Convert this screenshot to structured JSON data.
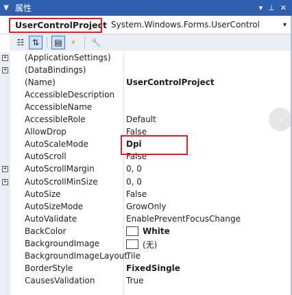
{
  "window": {
    "title": "属性",
    "menu_icon": "triangle-down-icon",
    "controls": {
      "dropdown": "▾",
      "pin": "⊥",
      "close": "✕"
    }
  },
  "object_selector": {
    "name": "UserControlProject",
    "type": "System.Windows.Forms.UserControl"
  },
  "toolbar": {
    "buttons": [
      {
        "icon": "categorized-icon",
        "glyph": "☷",
        "active": false
      },
      {
        "icon": "alphabetical-icon",
        "glyph": "⇅",
        "active": true
      },
      {
        "icon": "properties-icon",
        "glyph": "▤",
        "active": true
      },
      {
        "icon": "events-icon",
        "glyph": "⚡",
        "active": false
      },
      {
        "icon": "property-pages-icon",
        "glyph": "🔧",
        "active": false
      }
    ]
  },
  "properties": [
    {
      "name": "(ApplicationSettings)",
      "value": "",
      "expandable": true
    },
    {
      "name": "(DataBindings)",
      "value": "",
      "expandable": true
    },
    {
      "name": "(Name)",
      "value": "UserControlProject",
      "bold": true
    },
    {
      "name": "AccessibleDescription",
      "value": ""
    },
    {
      "name": "AccessibleName",
      "value": ""
    },
    {
      "name": "AccessibleRole",
      "value": "Default"
    },
    {
      "name": "AllowDrop",
      "value": "False"
    },
    {
      "name": "AutoScaleMode",
      "value": "Dpi",
      "bold": true
    },
    {
      "name": "AutoScroll",
      "value": "False"
    },
    {
      "name": "AutoScrollMargin",
      "value": "0, 0",
      "expandable": true
    },
    {
      "name": "AutoScrollMinSize",
      "value": "0, 0",
      "expandable": true
    },
    {
      "name": "AutoSize",
      "value": "False"
    },
    {
      "name": "AutoSizeMode",
      "value": "GrowOnly"
    },
    {
      "name": "AutoValidate",
      "value": "EnablePreventFocusChange"
    },
    {
      "name": "BackColor",
      "value": "White",
      "bold": true,
      "swatch": true
    },
    {
      "name": "BackgroundImage",
      "value": "(无)",
      "swatch": true
    },
    {
      "name": "BackgroundImageLayout",
      "value": "Tile"
    },
    {
      "name": "BorderStyle",
      "value": "FixedSingle",
      "bold": true
    },
    {
      "name": "CausesValidation",
      "value": "True"
    }
  ],
  "colors": {
    "titlebar": "#2f5fae",
    "highlight_box": "#e0201c"
  }
}
